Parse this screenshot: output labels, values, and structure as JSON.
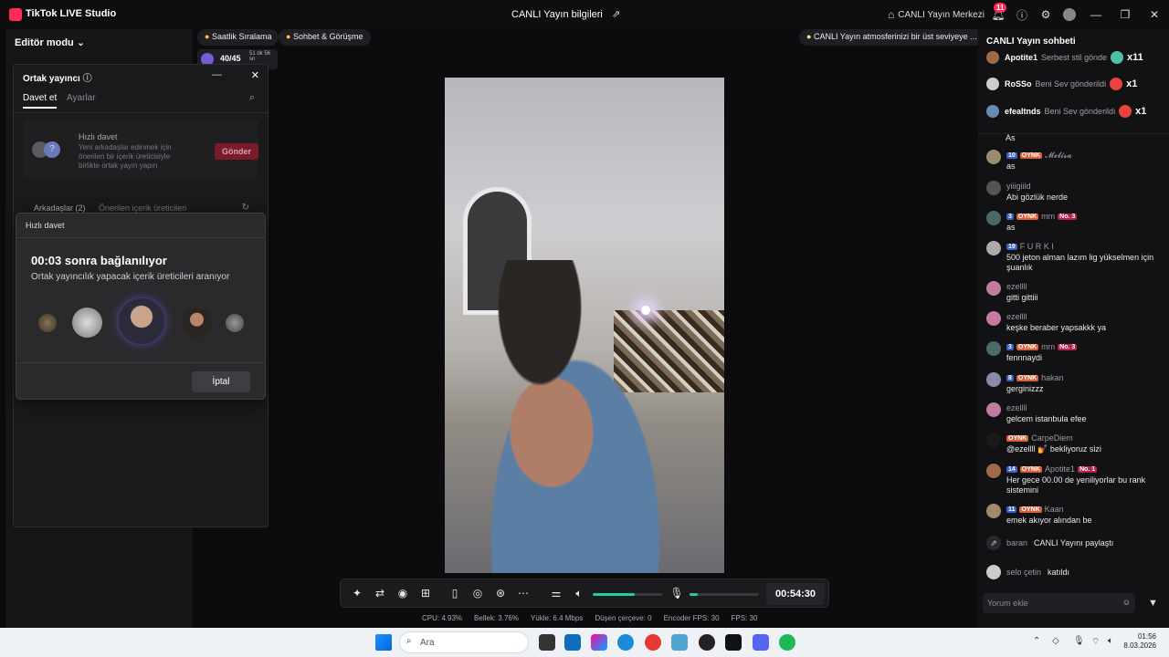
{
  "titlebar": {
    "app_name": "TikTok LIVE Studio",
    "center_title": "CANLI Yayın bilgileri",
    "live_center": "CANLI Yayın Merkezi",
    "notif_count": "11"
  },
  "left": {
    "editor_mode": "Editör modu",
    "goal_value": "40/45",
    "goal_time": "51 dk 56 sn"
  },
  "pills": {
    "hourly": "Saatlik Sıralama",
    "chat_meet": "Sohbet & Görüşme",
    "tip": "CANLI Yayın atmosferinizi bir üst seviyeye ..."
  },
  "cohost": {
    "title": "Ortak yayıncı",
    "tab_invite": "Davet et",
    "tab_settings": "Ayarlar",
    "quick_invite_title": "Hızlı davet",
    "quick_invite_desc": "Yeni arkadaşlar edinmek için önerilen bir içerik üreticisiyle birlikte ortak yayın yapın",
    "send_label": "Gönder",
    "friends_tab": "Arkadaşlar (2)",
    "suggested_tab": "Önerilen içerik üreticileri"
  },
  "dialog": {
    "header": "Hızlı davet",
    "countdown": "00:03 sonra bağlanılıyor",
    "subtitle": "Ortak yayıncılık yapacak içerik üreticileri aranıyor",
    "cancel_label": "İptal"
  },
  "controls": {
    "timer": "00:54:30",
    "volume_level": 0.6,
    "mic_level": 0.12
  },
  "stats": {
    "cpu": "CPU:  4.93%",
    "memory": "Bellek:  3.76%",
    "upload": "Yükle:  6.4 Mbps",
    "dropped": "Düşen çerçeve:  0",
    "encoder_fps": "Encoder FPS:  30",
    "fps": "FPS:  30"
  },
  "chat": {
    "title": "CANLI Yayın sohbeti",
    "gifts": [
      {
        "name": "Apotite1",
        "text": "Serbest stil gönde",
        "count": "x11"
      },
      {
        "name": "RoSSo",
        "text": "Beni Sev gönderildi",
        "count": "x1"
      },
      {
        "name": "efealtnds",
        "text": "Beni Sev gönderildi",
        "count": "x1"
      }
    ],
    "top_text": "As",
    "messages": [
      {
        "lv": "10",
        "fan": "OYNK",
        "name": "𝓜𝓮𝓵𝓲𝓼𝓪",
        "rank": "",
        "text": "as"
      },
      {
        "lv": "",
        "fan": "",
        "name": "yiiigiild",
        "rank": "",
        "text": "Abi gözlük nerde"
      },
      {
        "lv": "3",
        "fan": "OYNK",
        "name": "mm",
        "rank": "No. 3",
        "text": "as"
      },
      {
        "lv": "19",
        "fan": "",
        "name": "F U R K I",
        "rank": "",
        "text": "500 jeton alman lazım lig yükselmen için şuanlık"
      },
      {
        "lv": "",
        "fan": "",
        "name": "ezellll",
        "rank": "",
        "text": "gitti gittiii"
      },
      {
        "lv": "",
        "fan": "",
        "name": "ezellll",
        "rank": "",
        "text": "keşke beraber yapsakkk ya"
      },
      {
        "lv": "3",
        "fan": "OYNK",
        "name": "mm",
        "rank": "No. 3",
        "text": "fennnaydi"
      },
      {
        "lv": "8",
        "fan": "OYNK",
        "name": "hakan",
        "rank": "",
        "text": "gerginizzz"
      },
      {
        "lv": "",
        "fan": "",
        "name": "ezellll",
        "rank": "",
        "text": "gelcem istanbula efee"
      },
      {
        "lv": "",
        "fan": "OYNK",
        "name": "CarpeDiem",
        "rank": "",
        "text": "@ezellll 💅 bekliyoruz sizi"
      },
      {
        "lv": "14",
        "fan": "OYNK",
        "name": "Apotite1",
        "rank": "No. 1",
        "text": "Her gece 00.00 de yeniliyorlar bu rank sistemini"
      },
      {
        "lv": "11",
        "fan": "OYNK",
        "name": "Kaan",
        "rank": "",
        "text": "emek akıyor alından be"
      }
    ],
    "share_name": "baran",
    "share_text": "CANLI Yayını paylaştı",
    "join_name": "selo çetin",
    "join_text": "katıldı",
    "input_placeholder": "Yorum ekle"
  },
  "taskbar": {
    "search_placeholder": "Ara",
    "time": "01:56",
    "date": "8.03.2026"
  }
}
